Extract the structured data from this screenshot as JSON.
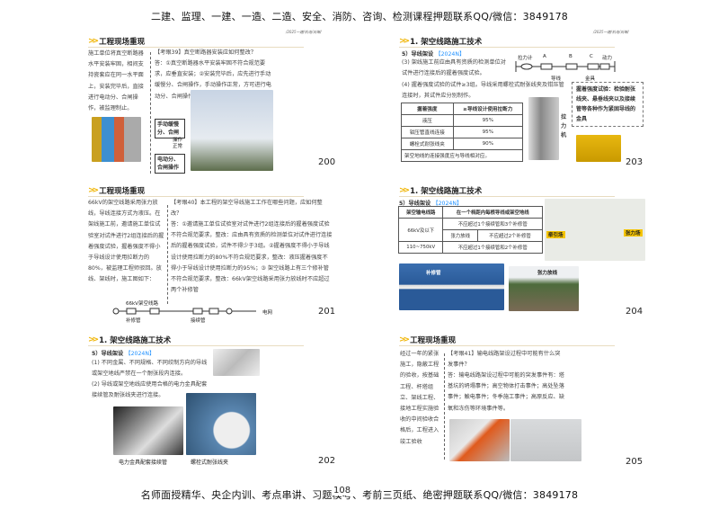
{
  "header_banner": "二建、监理、一建、一造、二造、安全、消防、咨询、检测课程押题联系QQ/微信：3849178",
  "footer_banner": "名师面授精华、央企内训、考点串讲、习题模考、考前三页纸、绝密押题联系QQ/微信：3849178",
  "page_number": "108",
  "slide_note": "/2025一建/机电/尚琳/",
  "slides": {
    "s200": {
      "title": "工程现场重现",
      "left_text": "施工单位将真空断路器水平安装牢固，相间支持瓷套应在同一水平面上，安装完毕后，直接进行电动分、合闸操作，被监理制止。",
      "question": "【考眼39】真空断路器安装应如何整改？",
      "answer": "答：①真空断路器水平安装牢固不符合规范要求，应垂直安装；②安装完毕后，应先进行手动缓慢分、合闸操作，手动操作正常，方可进行电动分、合闸操作。",
      "flow": [
        "手动缓慢分、合闸",
        "操作正常",
        "电动分、合闸操作"
      ],
      "page": "200"
    },
    "s201": {
      "title": "工程现场重现",
      "left_text": "66kV的架空线路采用张力放线，导线连接方式为液压。在架线施工前，邀请施工单位试验室对试件进行2组连接后的握着强度试验，握着强度不得小于导线设计使用拉断力的80%，被监理工程师驳回。放线、架线时，施工图如下：",
      "question": "【考眼40】本工程的架空导线施工工作在哪些问题，应如何整改？",
      "answer": "答：①邀请施工单位试验室对试件进行2组连接后的握着强度试验不符合规范要求，整改：应由具有资质的检测单位对试件进行连接后的握着强度试验，试件不得少于3组。②握着强度不得小于导线设计使用拉断力的80%不符合规范要求，整改：液压握着强度不得小于导线设计使用拉断力的95%；③ 架空线路上有三个修补管不符合规范要求，整改：66kV架空线路采用张力放线时不应超过两个补修管",
      "diagram": {
        "line_label": "66kV架空线路",
        "repair": "补修管",
        "joint": "接续管",
        "grid": "电网"
      },
      "page": "201"
    },
    "s202": {
      "title": "1. 架空线路施工技术",
      "sub": "5）导线架设",
      "year": "【2024N】",
      "p1": "(1) 不同金属、不同规格、不同绞制方向的导线或架空地线严禁在一个耐张段内连接。",
      "p2": "(2) 导线或架空地线应使用合格的电力金具配套接续管及耐张线夹进行连接。",
      "cap1": "电力金具配套接续管",
      "cap2": "螺栓式耐张线夹",
      "page": "202"
    },
    "s203": {
      "title": "1. 架空线路施工技术",
      "sub": "5）导线架设",
      "year": "【2024N】",
      "p3": "(3) 架线施工前应由具有资质的检测单位对试件进行连接后的握着强度试验。",
      "p4": "(4) 握着强度试验的试件≥3组。导线采用螺栓式耐张线夹及钳压管连接时，其试件应分别制作。",
      "diagram": {
        "meter": "拉力计",
        "a": "A",
        "b": "B",
        "c": "C",
        "power": "动力",
        "wire": "导线",
        "fitting": "金具"
      },
      "table": {
        "headers": [
          "握着强度",
          "≥导线设计使用拉断力"
        ],
        "rows": [
          [
            "液压",
            "95%"
          ],
          [
            "钳压管直线连接",
            "95%"
          ],
          [
            "螺栓式耐张线夹",
            "90%"
          ]
        ],
        "footer": "架空地线的连接强度应与导线相对应。"
      },
      "machine_label": "拉力机",
      "callout": "握着强度试验：检验耐张线夹、悬垂线夹以及接续管等各种作为紧固导线的金具",
      "page": "203"
    },
    "s204": {
      "title": "1. 架空线路施工技术",
      "sub": "5）导线架设",
      "year": "【2024N】",
      "table": {
        "h1": "架空输电线路",
        "h2": "在一个档距内每根导线或架空地线",
        "r1c1": "66kV及以下",
        "r1c2": "不应超过1个接续管和3个补修管",
        "r2a": "张力放线",
        "r2b": "不应超过2个补修管",
        "r3c1": "110~750kV",
        "r3c2": "不应超过1个接续管和2个补修管"
      },
      "aerial_labels": [
        "牵引场",
        "张力场"
      ],
      "pipe_label": "补修管",
      "tension_label": "张力放线",
      "page": "204"
    },
    "s205": {
      "title": "工程现场重现",
      "left_text": "经过一年的紧张施工，隐蔽工程的验收，按基础工程、杆塔组立、架线工程、接地工程实施验收的中间验收合格后，工程进入竣工验收",
      "question": "【考眼41】输电线路架设过程中可能有什么突发事件？",
      "answer": "答：输电线路架设过程中可能的突发事件有：塔基坑的坍塌事件；高空物体打击事件；高处坠落事件；触电事件；冬季施工事件；高原反应、缺氧和冻伤等环境事件等。",
      "page": "205"
    }
  },
  "colors": {
    "accent": "#f0b400",
    "year": "#1e90ff"
  }
}
